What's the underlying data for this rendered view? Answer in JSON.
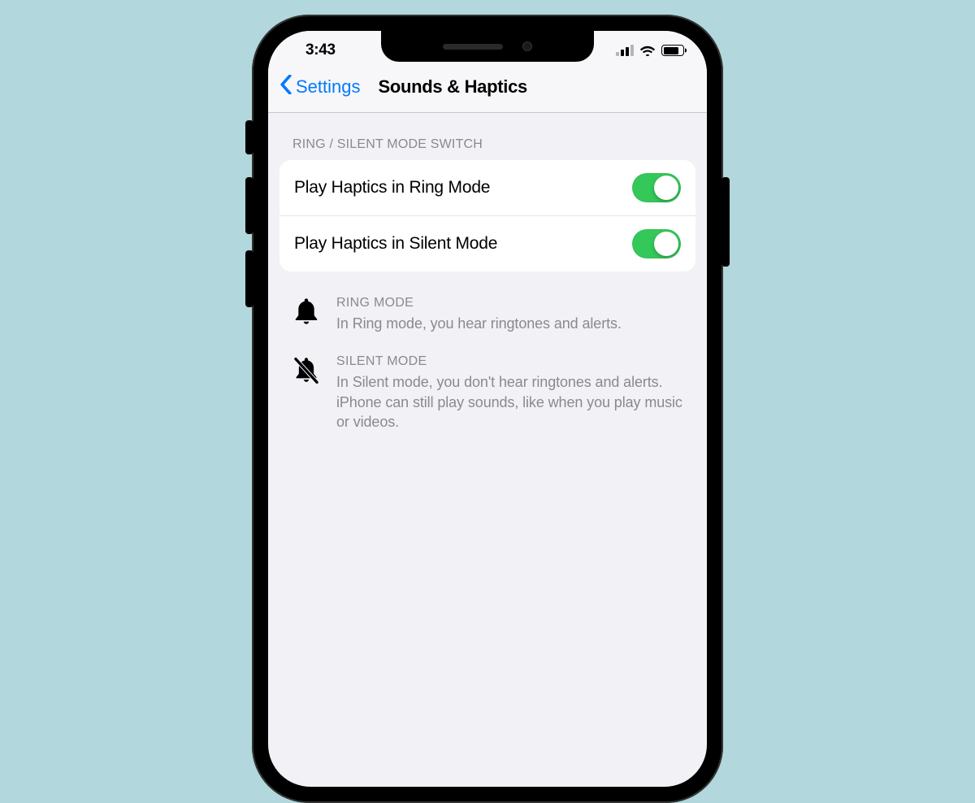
{
  "status": {
    "time": "3:43"
  },
  "nav": {
    "back_label": "Settings",
    "title": "Sounds & Haptics"
  },
  "section_header": "RING / SILENT MODE SWITCH",
  "rows": [
    {
      "label": "Play Haptics in Ring Mode",
      "on": true
    },
    {
      "label": "Play Haptics in Silent Mode",
      "on": true
    }
  ],
  "info": {
    "ring": {
      "heading": "RING MODE",
      "body": "In Ring mode, you hear ringtones and alerts."
    },
    "silent": {
      "heading": "SILENT MODE",
      "body": "In Silent mode, you don't hear ringtones and alerts. iPhone can still play sounds, like when you play music or videos."
    }
  },
  "colors": {
    "toggle_on": "#34c759",
    "link": "#007aff",
    "bg": "#f2f2f6"
  }
}
